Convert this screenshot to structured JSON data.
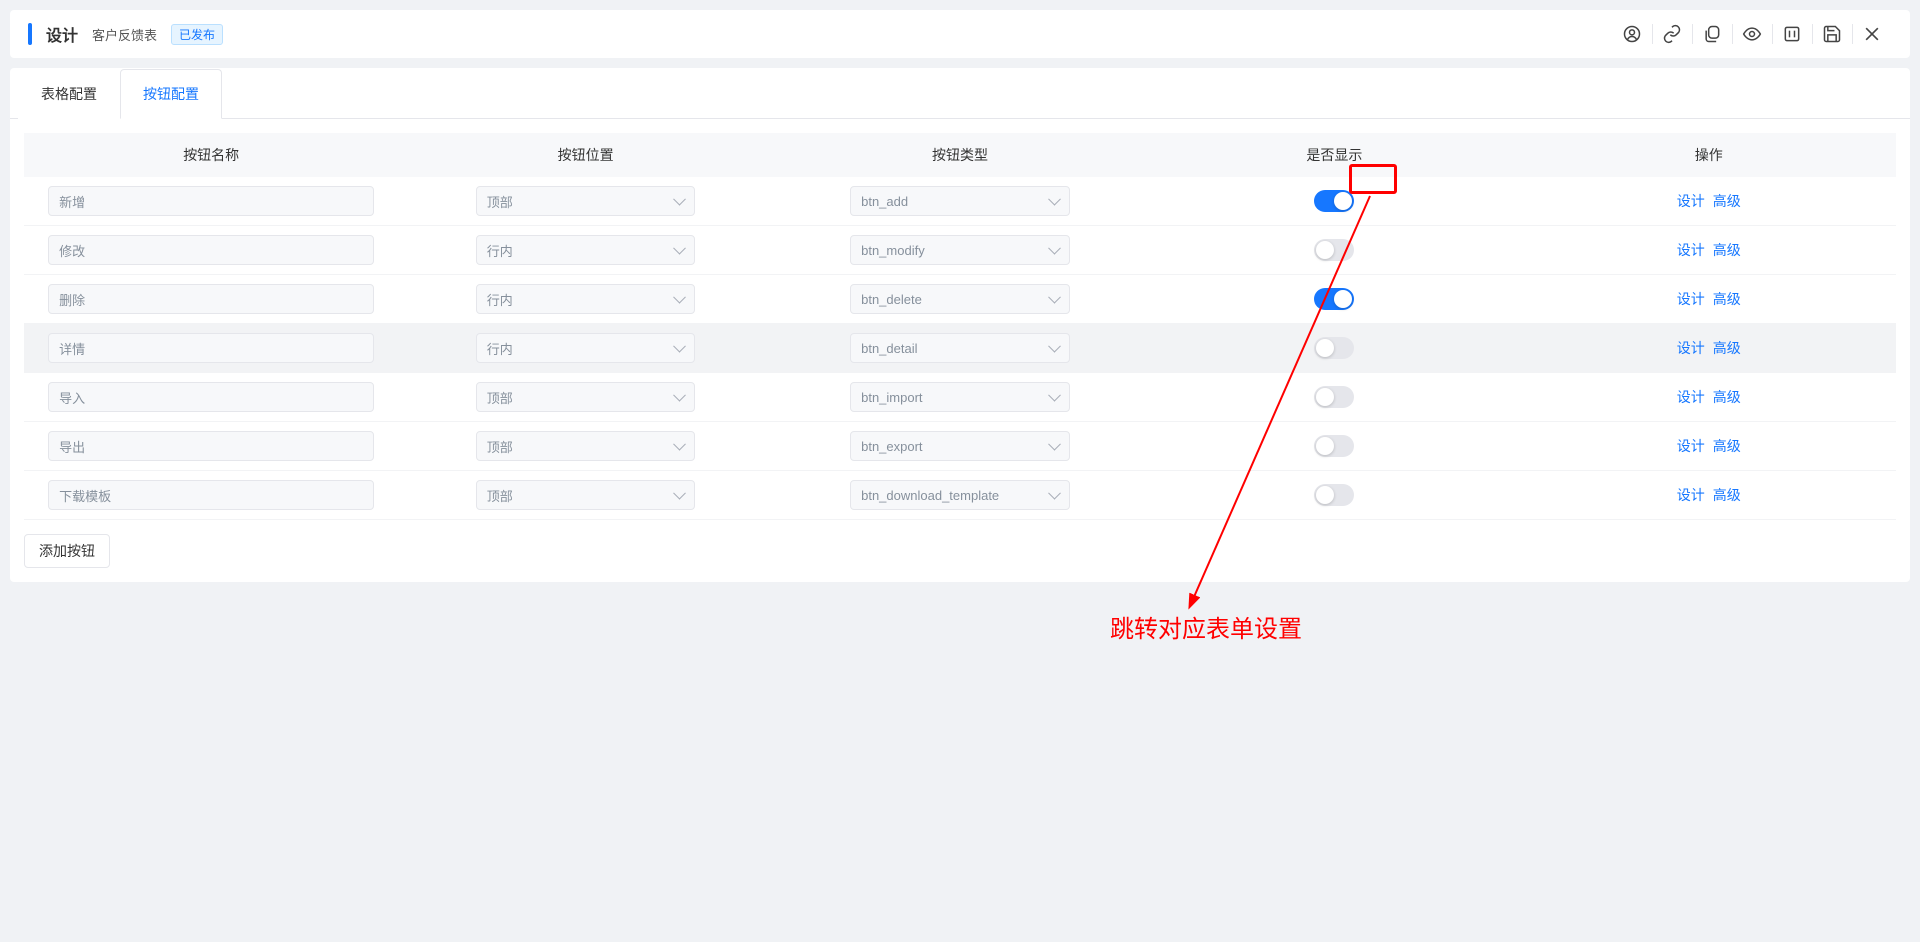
{
  "header": {
    "title": "设计",
    "subtitle": "客户反馈表",
    "status_tag": "已发布"
  },
  "tabs": {
    "table_config": "表格配置",
    "button_config": "按钮配置"
  },
  "table": {
    "headers": {
      "name": "按钮名称",
      "position": "按钮位置",
      "type": "按钮类型",
      "show": "是否显示",
      "action": "操作"
    },
    "rows": [
      {
        "name": "新增",
        "position": "顶部",
        "type": "btn_add",
        "show": true,
        "highlight": false
      },
      {
        "name": "修改",
        "position": "行内",
        "type": "btn_modify",
        "show": false,
        "highlight": false
      },
      {
        "name": "删除",
        "position": "行内",
        "type": "btn_delete",
        "show": true,
        "highlight": false
      },
      {
        "name": "详情",
        "position": "行内",
        "type": "btn_detail",
        "show": false,
        "highlight": true
      },
      {
        "name": "导入",
        "position": "顶部",
        "type": "btn_import",
        "show": false,
        "highlight": false
      },
      {
        "name": "导出",
        "position": "顶部",
        "type": "btn_export",
        "show": false,
        "highlight": false
      },
      {
        "name": "下载模板",
        "position": "顶部",
        "type": "btn_download_template",
        "show": false,
        "highlight": false
      }
    ],
    "action_links": {
      "design": "设计",
      "advanced": "高级"
    }
  },
  "add_button_label": "添加按钮",
  "annotation_text": "跳转对应表单设置"
}
